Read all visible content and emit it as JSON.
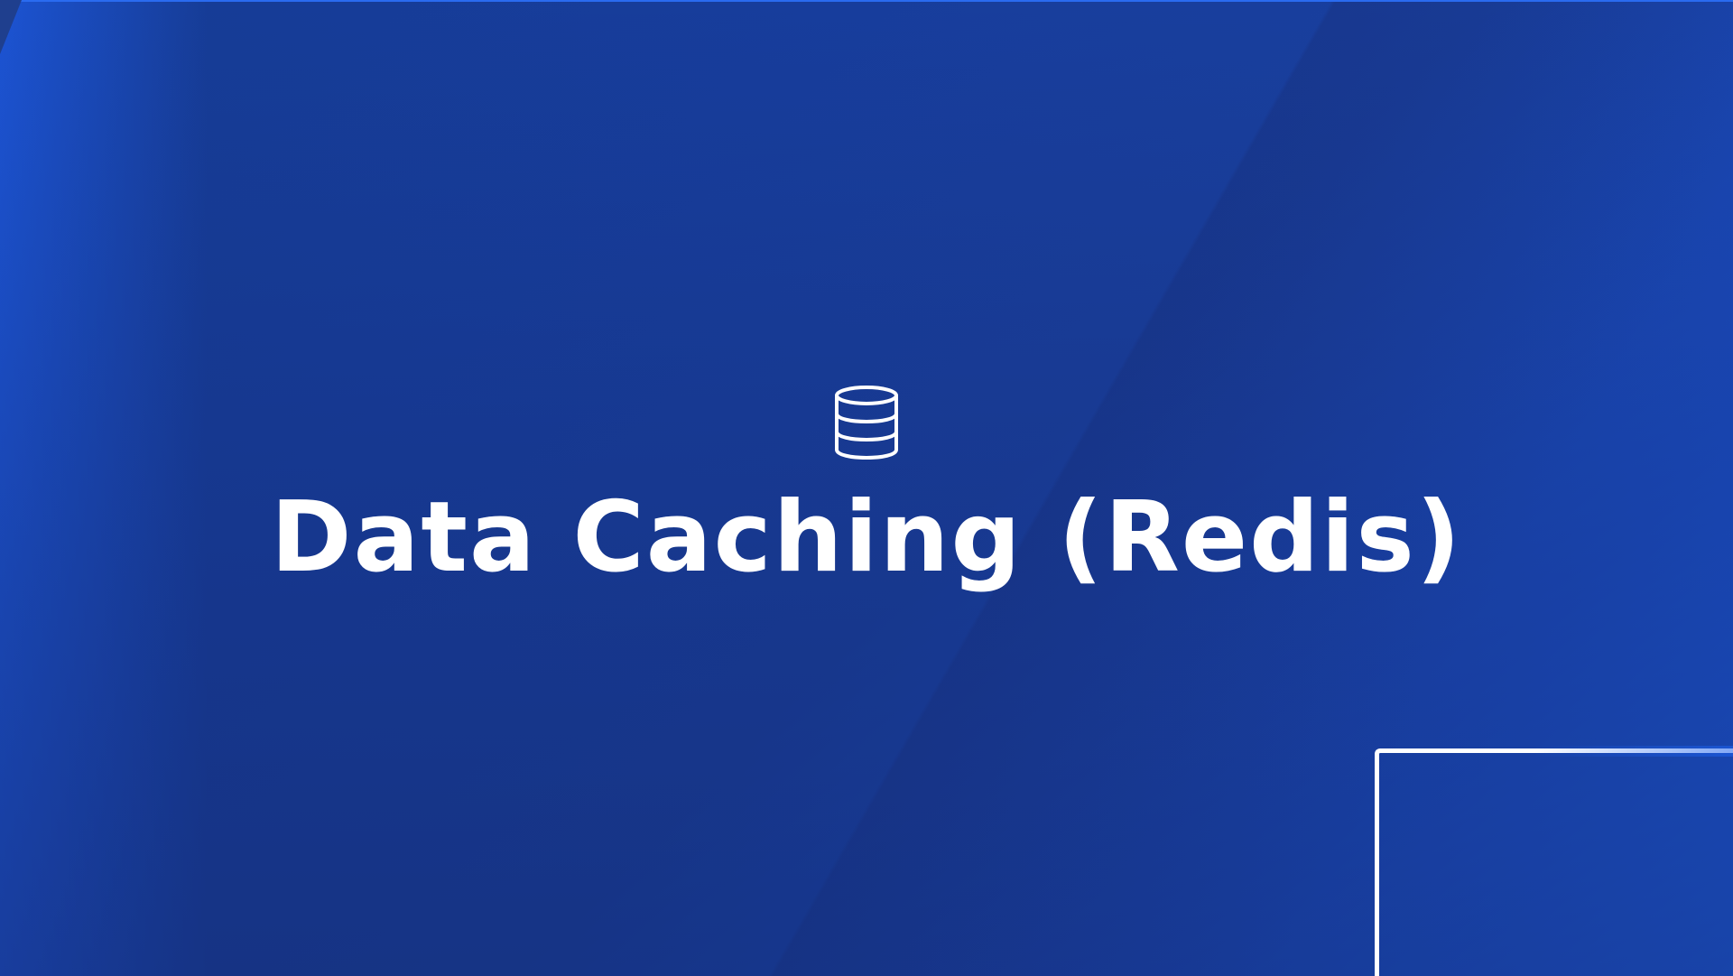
{
  "slide": {
    "title": "Data Caching (Redis)",
    "icon": "database-icon"
  },
  "colors": {
    "background_start": "#163c95",
    "background_end": "#1d62ee",
    "title_text": "#ffffff",
    "accent_line": "#ffffff"
  }
}
